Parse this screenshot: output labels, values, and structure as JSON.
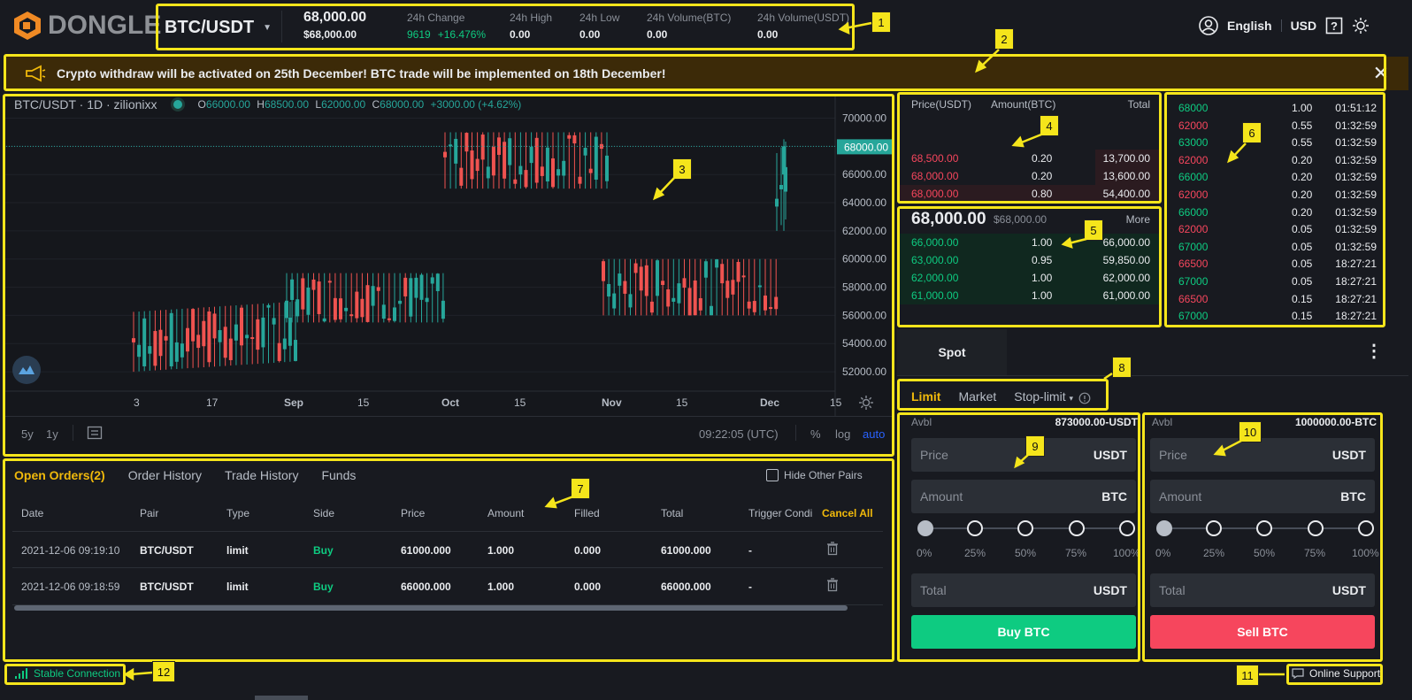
{
  "brand": {
    "name": "DONGLE"
  },
  "header": {
    "pair": "BTC/USDT",
    "last_price": "68,000.00",
    "last_price_usd": "$68,000.00",
    "stats": [
      {
        "label": "24h Change",
        "value": "9619",
        "value2": "+16.476%"
      },
      {
        "label": "24h High",
        "value": "0.00"
      },
      {
        "label": "24h Low",
        "value": "0.00"
      },
      {
        "label": "24h Volume(BTC)",
        "value": "0.00"
      },
      {
        "label": "24h Volume(USDT)",
        "value": "0.00"
      }
    ],
    "language": "English",
    "currency": "USD"
  },
  "announcement": {
    "text": "Crypto withdraw will be activated on 25th December! BTC trade will be implemented on 18th December!"
  },
  "chart": {
    "symbol": "BTC/USDT · 1D · zilionixx",
    "ohlc": {
      "o_label": "O",
      "o": "66000.00",
      "h_label": "H",
      "h": "68500.00",
      "l_label": "L",
      "l": "62000.00",
      "c_label": "C",
      "c": "68000.00",
      "change": "+3000.00 (+4.62%)"
    },
    "y_ticks": [
      "70000.00",
      "68000.00",
      "66000.00",
      "64000.00",
      "62000.00",
      "60000.00",
      "58000.00",
      "56000.00",
      "54000.00",
      "52000.00"
    ],
    "current_price_tag": "68000.00",
    "x_ticks": [
      "3",
      "17",
      "Sep",
      "15",
      "Oct",
      "15",
      "Nov",
      "15",
      "Dec",
      "15"
    ],
    "ranges": [
      "5y",
      "1y"
    ],
    "time": "09:22:05 (UTC)",
    "scale_opts": [
      "%",
      "log",
      "auto"
    ]
  },
  "chart_data": {
    "type": "candlestick",
    "y_range": [
      51000,
      70600
    ],
    "segments": [
      {
        "label": "Aug–Sep",
        "low": 52000,
        "high": 57000,
        "trend": "rising"
      },
      {
        "label": "Sep–Oct",
        "low": 55500,
        "high": 59000,
        "trend": "flat"
      },
      {
        "label": "Oct–Nov",
        "low": 65000,
        "high": 69000,
        "trend": "flat"
      },
      {
        "label": "Nov–Dec",
        "low": 56000,
        "high": 60000,
        "trend": "flat"
      },
      {
        "label": "Dec",
        "low": 62000,
        "high": 68500,
        "trend": "rising"
      }
    ],
    "last": {
      "open": 66000,
      "high": 68500,
      "low": 62000,
      "close": 68000
    }
  },
  "orderbook": {
    "headers": [
      "Price(USDT)",
      "Amount(BTC)",
      "Total"
    ],
    "asks": [
      {
        "price": "68,500.00",
        "amount": "0.20",
        "total": "13,700.00",
        "depth": 0.25
      },
      {
        "price": "68,000.00",
        "amount": "0.20",
        "total": "13,600.00",
        "depth": 0.25
      },
      {
        "price": "68,000.00",
        "amount": "0.80",
        "total": "54,400.00",
        "depth": 1.0
      }
    ],
    "mid_price": "68,000.00",
    "mid_usd": "$68,000.00",
    "more": "More",
    "bids": [
      {
        "price": "66,000.00",
        "amount": "1.00",
        "total": "66,000.00"
      },
      {
        "price": "63,000.00",
        "amount": "0.95",
        "total": "59,850.00"
      },
      {
        "price": "62,000.00",
        "amount": "1.00",
        "total": "62,000.00"
      },
      {
        "price": "61,000.00",
        "amount": "1.00",
        "total": "61,000.00"
      }
    ]
  },
  "trades": [
    {
      "price": "68000",
      "side": "buy",
      "amount": "1.00",
      "time": "01:51:12"
    },
    {
      "price": "62000",
      "side": "sell",
      "amount": "0.55",
      "time": "01:32:59"
    },
    {
      "price": "63000",
      "side": "buy",
      "amount": "0.55",
      "time": "01:32:59"
    },
    {
      "price": "62000",
      "side": "sell",
      "amount": "0.20",
      "time": "01:32:59"
    },
    {
      "price": "66000",
      "side": "buy",
      "amount": "0.20",
      "time": "01:32:59"
    },
    {
      "price": "62000",
      "side": "sell",
      "amount": "0.20",
      "time": "01:32:59"
    },
    {
      "price": "66000",
      "side": "buy",
      "amount": "0.20",
      "time": "01:32:59"
    },
    {
      "price": "62000",
      "side": "sell",
      "amount": "0.05",
      "time": "01:32:59"
    },
    {
      "price": "67000",
      "side": "buy",
      "amount": "0.05",
      "time": "01:32:59"
    },
    {
      "price": "66500",
      "side": "sell",
      "amount": "0.05",
      "time": "18:27:21"
    },
    {
      "price": "67000",
      "side": "buy",
      "amount": "0.05",
      "time": "18:27:21"
    },
    {
      "price": "66500",
      "side": "sell",
      "amount": "0.15",
      "time": "18:27:21"
    },
    {
      "price": "67000",
      "side": "buy",
      "amount": "0.15",
      "time": "18:27:21"
    }
  ],
  "spot": {
    "tab": "Spot",
    "order_types": [
      "Limit",
      "Market",
      "Stop-limit"
    ],
    "buy": {
      "avbl_label": "Avbl",
      "avbl": "873000.00-USDT",
      "price_ph": "Price",
      "price_unit": "USDT",
      "amount_ph": "Amount",
      "amount_unit": "BTC",
      "total_ph": "Total",
      "total_unit": "USDT",
      "button": "Buy BTC",
      "level": 0
    },
    "sell": {
      "avbl_label": "Avbl",
      "avbl": "1000000.00-BTC",
      "price_ph": "Price",
      "price_unit": "USDT",
      "amount_ph": "Amount",
      "amount_unit": "BTC",
      "total_ph": "Total",
      "total_unit": "USDT",
      "button": "Sell BTC",
      "level": 0
    },
    "pcts": [
      "0%",
      "25%",
      "50%",
      "75%",
      "100%"
    ]
  },
  "orders": {
    "tabs": [
      "Open Orders(2)",
      "Order History",
      "Trade History",
      "Funds"
    ],
    "hide_other": "Hide Other Pairs",
    "columns": [
      "Date",
      "Pair",
      "Type",
      "Side",
      "Price",
      "Amount",
      "Filled",
      "Total",
      "Trigger Condi"
    ],
    "cancel_all": "Cancel All",
    "rows": [
      {
        "date": "2021-12-06 09:19:10",
        "pair": "BTC/USDT",
        "type": "limit",
        "side": "Buy",
        "price": "61000.000",
        "amount": "1.000",
        "filled": "0.000",
        "total": "61000.000",
        "trigger": "-"
      },
      {
        "date": "2021-12-06 09:18:59",
        "pair": "BTC/USDT",
        "type": "limit",
        "side": "Buy",
        "price": "66000.000",
        "amount": "1.000",
        "filled": "0.000",
        "total": "66000.000",
        "trigger": "-"
      }
    ]
  },
  "footer": {
    "connection": "Stable Connection",
    "support": "Online Support"
  },
  "callouts": [
    "1",
    "2",
    "3",
    "4",
    "5",
    "6",
    "7",
    "8",
    "9",
    "10",
    "11",
    "12"
  ],
  "colors": {
    "up": "#0ecb81",
    "down": "#f6465d",
    "accent": "#f0b90b",
    "highlight": "#f5e51b"
  }
}
